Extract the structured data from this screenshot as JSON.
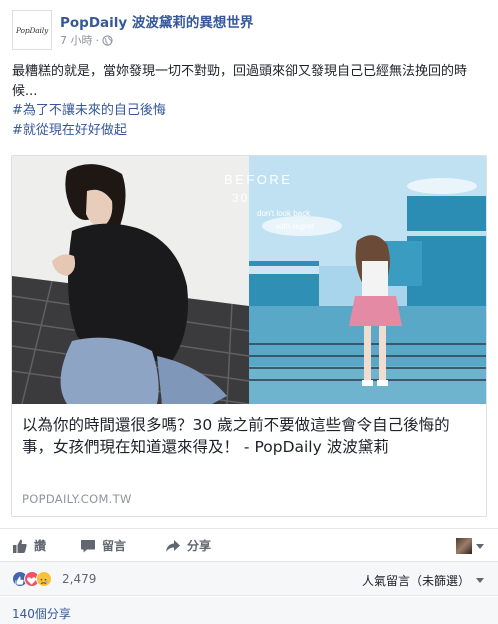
{
  "post": {
    "page_name": "PopDaily 波波黛莉的異想世界",
    "avatar_text": "PopDaily",
    "timestamp": "7 小時",
    "separator": "·",
    "body_line": "最糟糕的就是，當妳發現一切不對勁，回過頭來卻又發現自己已經無法挽回的時候...",
    "hashtags": [
      "#為了不讓未來的自己後悔",
      "#就從現在好好做起"
    ]
  },
  "card": {
    "image_text": {
      "before": "BEFORE",
      "age": "30",
      "line1": "don't look back",
      "line2": "with regret"
    },
    "title": "以為你的時間還很多嗎？30 歲之前不要做這些會令自己後悔的事，女孩們現在知道還來得及！ - PopDaily 波波黛莉",
    "domain": "POPDAILY.COM.TW"
  },
  "actions": {
    "like": "讚",
    "comment": "留言",
    "share": "分享"
  },
  "reactions": {
    "count": "2,479",
    "sort_label": "人氣留言（未篩選）"
  },
  "shares": {
    "label": "140個分享"
  },
  "colors": {
    "link_blue": "#365899",
    "like_blue": "#4267b2",
    "love_red": "#f25268",
    "sad_yellow": "#f7c13a"
  }
}
